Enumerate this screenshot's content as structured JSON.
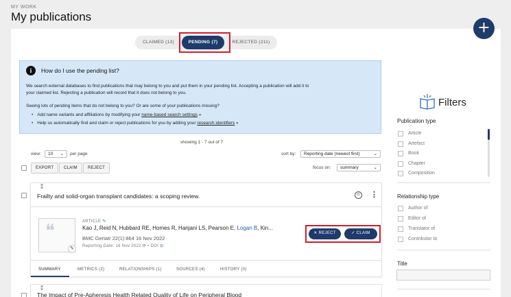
{
  "header": {
    "kicker": "MY WORK",
    "title": "My publications",
    "add_label": "+"
  },
  "tabs": [
    {
      "label": "CLAIMED (13)"
    },
    {
      "label": "PENDING (7)"
    },
    {
      "label": "REJECTED (211)"
    }
  ],
  "info": {
    "heading": "How do I use the pending list?",
    "p1_line1": "We search external databases to find publications that may belong to you and put them in your pending list. Accepting a publication will add it to",
    "p1_line2": "your claimed list. Rejecting a publication will record that it does not belong to you.",
    "p2": "Seeing lots of pending items that do not belong to you? Or are some of your publications missing?",
    "li1_pre": "Add name variants and affiliations by modifying your ",
    "li1_link": "name-based search settings",
    "li1_post": " »",
    "li2_pre": "Help us automatically find and claim or reject publications for you by adding your ",
    "li2_link": "research identifiers",
    "li2_post": " »"
  },
  "list": {
    "showing": "showing 1 - 7 out of 7",
    "view_label": "view:",
    "view_value": "10",
    "per_page": "per page",
    "sort_label": "sort by:",
    "sort_value": "Reporting date (newest first)",
    "focus_label": "focus on:",
    "focus_value": "summary",
    "bulk": {
      "export": "EXPORT",
      "claim": "CLAIM",
      "reject": "REJECT"
    }
  },
  "publication": {
    "title": "Frailty and solid-organ transplant candidates: a scoping review.",
    "type": "ARTICLE",
    "authors_pre": "Kao J, Reid N, Hubbard RE, Homes R, Hanjani LS, Pearson E, ",
    "authors_link": "Logan B",
    "authors_post": ", Kin...",
    "journal": "BMC Geriatr 22(1):864 16 Nov 2022",
    "reporting": "Reporting Date: 16 Nov 2022",
    "doi": "DOI",
    "reject_label": "REJECT",
    "claim_label": "CLAIM",
    "subtabs": [
      "SUMMARY",
      "METRICS (2)",
      "RELATIONSHIPS (1)",
      "SOURCES (4)",
      "HISTORY (0)"
    ]
  },
  "publication2": {
    "title": "The Impact of Pre-Apheresis Health Related Quality of Life on Peripheral Blood"
  },
  "filters": {
    "title": "Filters",
    "pubtype_heading": "Publication type",
    "pubtypes": [
      "Article",
      "Artefact",
      "Book",
      "Chapter",
      "Composition"
    ],
    "rel_heading": "Relationship type",
    "reltypes": [
      "Author of",
      "Editor of",
      "Translator of",
      "Contributor to"
    ],
    "title_heading": "Title"
  },
  "colors": {
    "primary": "#1e3b6b",
    "highlight": "#cc1f2a",
    "info_bg": "#d6e8f8"
  }
}
